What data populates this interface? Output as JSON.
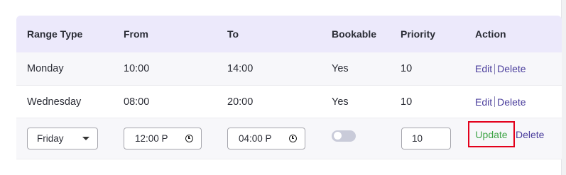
{
  "columns": [
    "Range Type",
    "From",
    "To",
    "Bookable",
    "Priority",
    "Action"
  ],
  "rows": [
    {
      "range_type": "Monday",
      "from": "10:00",
      "to": "14:00",
      "bookable": "Yes",
      "priority": "10",
      "edit": "Edit",
      "delete": "Delete"
    },
    {
      "range_type": "Wednesday",
      "from": "08:00",
      "to": "20:00",
      "bookable": "Yes",
      "priority": "10",
      "edit": "Edit",
      "delete": "Delete"
    }
  ],
  "edit_row": {
    "range_type_value": "Friday",
    "from_value": "12:00 P",
    "to_value": "04:00 P",
    "bookable_on": false,
    "priority_value": "10",
    "update_label": "Update",
    "delete_label": "Delete"
  },
  "colors": {
    "header_bg": "#ece9fb",
    "action_link": "#4a3d9c",
    "update_link": "#3fa447",
    "highlight_border": "#e3001b"
  }
}
